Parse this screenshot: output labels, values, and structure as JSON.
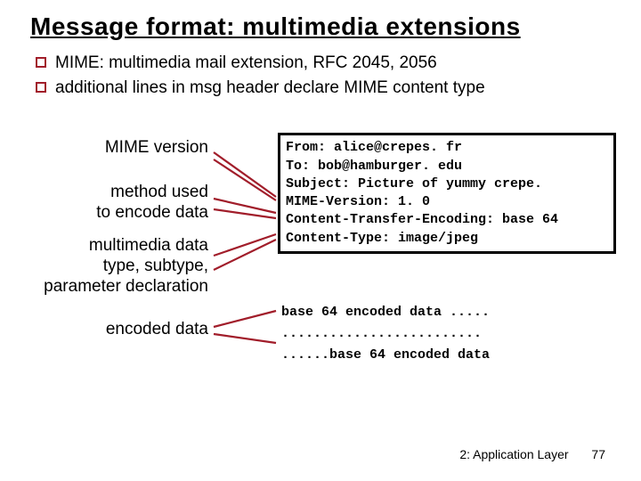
{
  "title": "Message format: multimedia extensions",
  "bullets": {
    "b1": "MIME: multimedia mail extension, RFC 2045, 2056",
    "b2": "additional lines in msg header declare MIME content type"
  },
  "labels": {
    "l1": "MIME version",
    "l2a": "method used",
    "l2b": "to encode data",
    "l3a": "multimedia data",
    "l3b": "type, subtype,",
    "l3c": "parameter declaration",
    "l4": "encoded data"
  },
  "code": {
    "c1": "From: alice@crepes. fr",
    "c2": "To: bob@hamburger. edu",
    "c3": "Subject: Picture of yummy crepe.",
    "c4": "MIME-Version: 1. 0",
    "c5": "Content-Transfer-Encoding: base 64",
    "c6": "Content-Type: image/jpeg"
  },
  "encoded": {
    "e1": "base 64 encoded data .....",
    "e2": ".........................",
    "e3": "......base 64 encoded data"
  },
  "footer": {
    "chapter": "2: Application Layer",
    "page": "77"
  }
}
